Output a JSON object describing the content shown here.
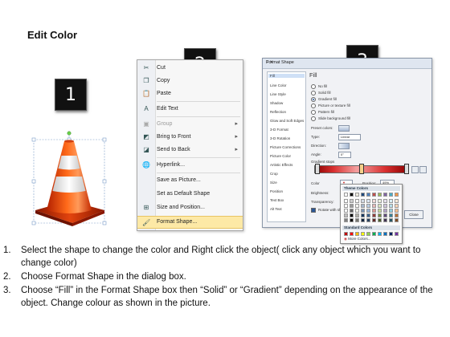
{
  "page_title": "Edit Color",
  "steps": [
    "1",
    "2",
    "3"
  ],
  "context_menu": {
    "items": [
      {
        "label": "Cut",
        "icon": "scissors-icon",
        "disabled": false,
        "submenu": false
      },
      {
        "label": "Copy",
        "icon": "copy-icon",
        "disabled": false,
        "submenu": false
      },
      {
        "label": "Paste",
        "icon": "paste-icon",
        "disabled": false,
        "submenu": false
      },
      {
        "label": "Edit Text",
        "icon": "edit-text-icon",
        "disabled": false,
        "submenu": false
      },
      {
        "label": "Group",
        "icon": "group-icon",
        "disabled": true,
        "submenu": true
      },
      {
        "label": "Bring to Front",
        "icon": "bring-front-icon",
        "disabled": false,
        "submenu": true
      },
      {
        "label": "Send to Back",
        "icon": "send-back-icon",
        "disabled": false,
        "submenu": true
      },
      {
        "label": "Hyperlink...",
        "icon": "hyperlink-icon",
        "disabled": false,
        "submenu": false
      },
      {
        "label": "Save as Picture...",
        "icon": "",
        "disabled": false,
        "submenu": false
      },
      {
        "label": "Set as Default Shape",
        "icon": "",
        "disabled": false,
        "submenu": false
      },
      {
        "label": "Size and Position...",
        "icon": "size-position-icon",
        "disabled": false,
        "submenu": false
      },
      {
        "label": "Format Shape...",
        "icon": "format-shape-icon",
        "disabled": false,
        "submenu": false,
        "highlighted": true
      }
    ]
  },
  "dialog": {
    "title": "Format Shape",
    "window_buttons": "? ✕",
    "categories": [
      "Fill",
      "Line Color",
      "Line Style",
      "Shadow",
      "Reflection",
      "Glow and Soft Edges",
      "3-D Format",
      "3-D Rotation",
      "Picture Corrections",
      "Picture Color",
      "Artistic Effects",
      "Crop",
      "Size",
      "Position",
      "Text Box",
      "Alt Text"
    ],
    "selected_category": "Fill",
    "section_title": "Fill",
    "fill_options": [
      "No fill",
      "Solid fill",
      "Gradient fill",
      "Picture or texture fill",
      "Pattern fill",
      "Slide background fill"
    ],
    "selected_fill": "Gradient fill",
    "preset_colors_label": "Preset colors:",
    "type_label": "Type:",
    "type_value": "Linear",
    "direction_label": "Direction:",
    "angle_label": "Angle:",
    "angle_value": "0°",
    "gradient_stops_label": "Gradient stops",
    "color_label": "Color",
    "position_label": "Position:",
    "position_value": "49%",
    "brightness_label": "Brightness:",
    "transparency_label": "Transparency:",
    "rotate_label": "Rotate with shape",
    "close_label": "Close"
  },
  "palette": {
    "theme_colors_label": "Theme Colors",
    "standard_colors_label": "Standard Colors",
    "more_colors_label": "More Colors...",
    "theme_top": [
      "#ffffff",
      "#000000",
      "#eeece1",
      "#1f497d",
      "#4f81bd",
      "#c0504d",
      "#9bbb59",
      "#8064a2",
      "#4bacc6",
      "#f79646"
    ],
    "standard": [
      "#c00000",
      "#ff0000",
      "#ffc000",
      "#ffff00",
      "#92d050",
      "#00b050",
      "#00b0f0",
      "#0070c0",
      "#002060",
      "#7030a0"
    ]
  },
  "instructions": [
    {
      "num": "1.",
      "text": "Select the shape to change the color and Right click the object( click any object which you want to change color)"
    },
    {
      "num": "2.",
      "text": "Choose Format Shape in the dialog box."
    },
    {
      "num": "3.",
      "text": "Choose “Fill” in the Format Shape box then “Solid” or “Gradient” depending on the appearance of the object. Change colour as shown in the picture."
    }
  ]
}
